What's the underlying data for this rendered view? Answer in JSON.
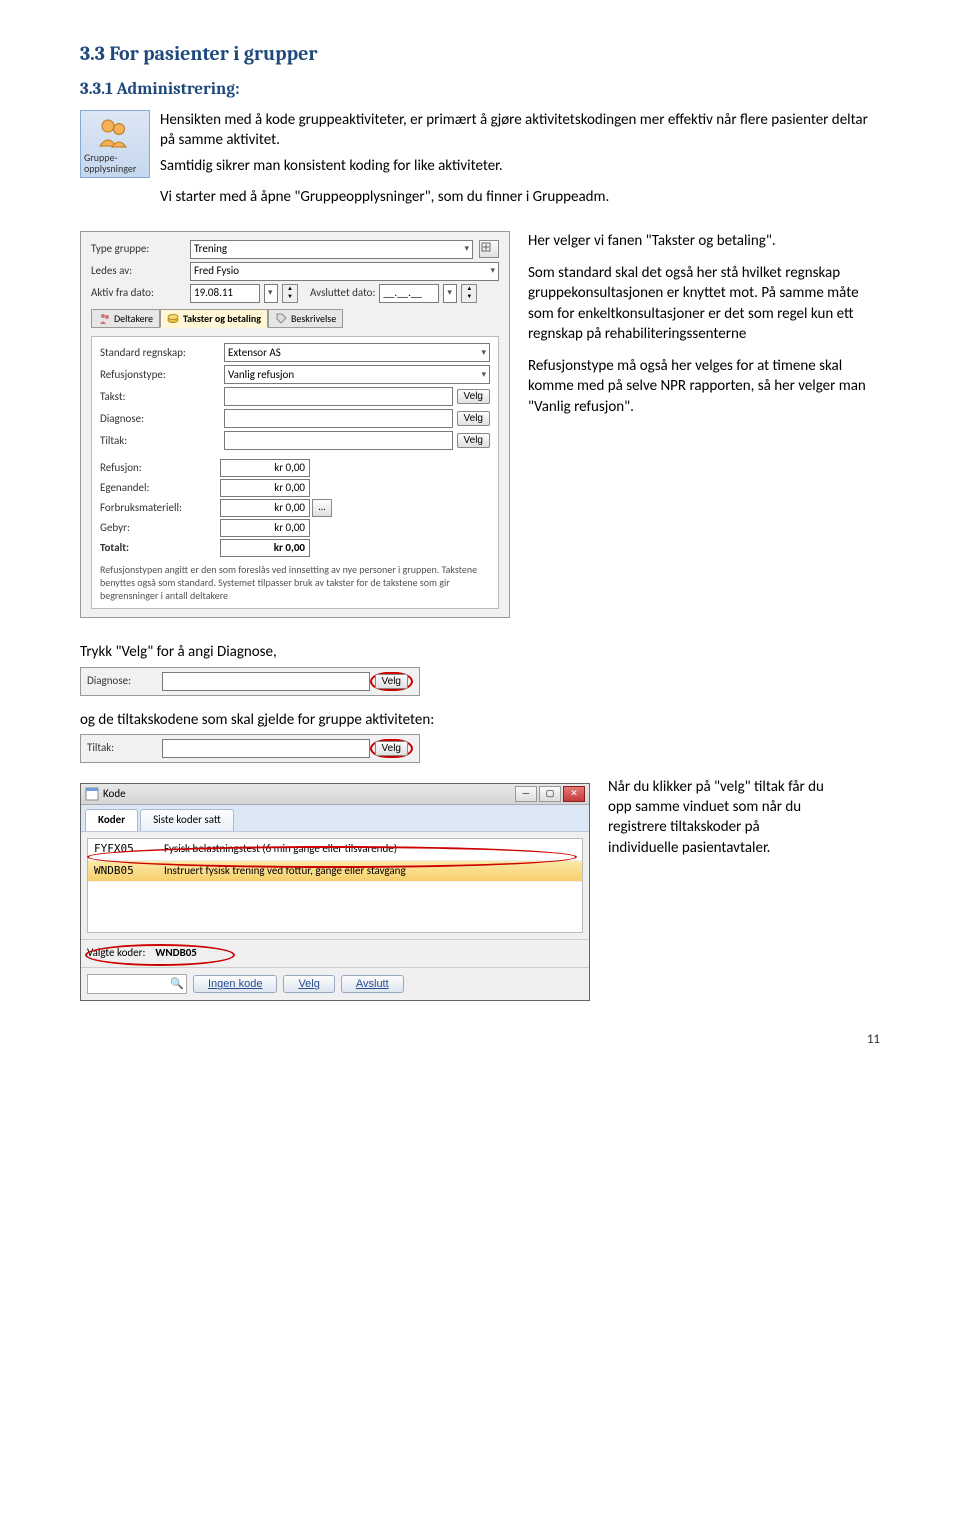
{
  "h2": "3.3 For pasienter i grupper",
  "h3": "3.3.1 Administrering:",
  "icon_tile_label": "Gruppe-opplysninger",
  "para1": "Hensikten med å kode gruppeaktiviteter, er primært å gjøre aktivitetskodingen mer effektiv når flere pasienter deltar på samme aktivitet.",
  "para2": "Samtidig sikrer man konsistent koding for like aktiviteter.",
  "para3": "Vi starter med å åpne \"Gruppeopplysninger\", som du finner i Gruppeadm.",
  "panel": {
    "type_gruppe_label": "Type gruppe:",
    "type_gruppe_value": "Trening",
    "ledes_av_label": "Ledes av:",
    "ledes_av_value": "Fred Fysio",
    "aktiv_fra_label": "Aktiv fra dato:",
    "aktiv_fra_value": "19.08.11",
    "avsluttet_label": "Avsluttet dato:",
    "avsluttet_value": "__.__.__",
    "tabs": {
      "deltakere": "Deltakere",
      "takster": "Takster og betaling",
      "beskrivelse": "Beskrivelse"
    },
    "standard_regnskap_label": "Standard regnskap:",
    "standard_regnskap_value": "Extensor AS",
    "refusjonstype_label": "Refusjonstype:",
    "refusjonstype_value": "Vanlig refusjon",
    "takst_label": "Takst:",
    "diagnose_label": "Diagnose:",
    "tiltak_label": "Tiltak:",
    "velg": "Velg",
    "refusjon_label": "Refusjon:",
    "egenandel_label": "Egenandel:",
    "forbruk_label": "Forbruksmateriell:",
    "gebyr_label": "Gebyr:",
    "totalt_label": "Totalt:",
    "kr0": "kr 0,00",
    "footnote": "Refusjonstypen angitt er den som foreslås ved innsetting av nye personer i gruppen. Takstene benyttes også som standard. Systemet tilpasser bruk av takster for de takstene som gir begrensninger i antall deltakere"
  },
  "side": {
    "p1": "Her velger vi fanen \"Takster og betaling\".",
    "p2": "Som standard skal det også her stå hvilket regnskap gruppekonsultasjonen er knyttet mot. På samme måte som for enkeltkonsultasjoner er det som regel kun ett regnskap på rehabiliteringssenterne",
    "p3": "Refusjonstype må også her velges for at timene skal komme med på selve NPR rapporten, så her velger man \"Vanlig refusjon\"."
  },
  "mid1": "Trykk \"Velg\" for å angi Diagnose,",
  "diag_field_label": "Diagnose:",
  "mid2": "og de tiltakskodene som skal gjelde for gruppe aktiviteten:",
  "tiltak_field_label": "Tiltak:",
  "kode": {
    "title": "Kode",
    "tab_koder": "Koder",
    "tab_siste": "Siste koder satt",
    "row1_code": "FYFX05",
    "row1_text": "Fysisk belastningstest (6 min gange eller tilsvarende)",
    "row2_code": "WNDB05",
    "row2_text": "Instruert fysisk trening ved fottur, gange eller stavgang",
    "valgte_label": "Valgte koder:",
    "valgte_value": "WNDB05",
    "btn_ingen": "Ingen kode",
    "btn_velg": "Velg",
    "btn_avslutt": "Avslutt"
  },
  "side2": "Når du klikker på \"velg\" tiltak får du opp samme vinduet som når du registrere tiltakskoder på individuelle pasientavtaler.",
  "page_num": "11"
}
